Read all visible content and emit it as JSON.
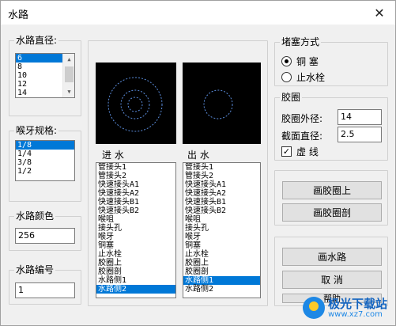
{
  "window": {
    "title": "水路",
    "close_glyph": "✕"
  },
  "pipe_diameter": {
    "legend": "水路直径:",
    "items": [
      "6",
      "8",
      "10",
      "12",
      "14"
    ],
    "selected_index": 0
  },
  "thread_spec": {
    "legend": "喉牙规格:",
    "items": [
      "1/8",
      "1/4",
      "3/8",
      "1/2"
    ],
    "selected_index": 0
  },
  "pipe_color": {
    "legend": "水路颜色",
    "value": "256"
  },
  "pipe_number": {
    "legend": "水路编号",
    "value": "1"
  },
  "inlet": {
    "label": "进 水",
    "items": [
      "管接头1",
      "管接头2",
      "快速接头A1",
      "快速接头A2",
      "快速接头B1",
      "快速接头B2",
      "喉咀",
      "接头孔",
      "喉牙",
      "铜塞",
      "止水栓",
      "胶圈上",
      "胶圈剖",
      "水路侧1",
      "水路侧2"
    ],
    "selected_index": 14
  },
  "outlet": {
    "label": "出 水",
    "items": [
      "管接头1",
      "管接头2",
      "快速接头A1",
      "快速接头A2",
      "快速接头B1",
      "快速接头B2",
      "喉咀",
      "接头孔",
      "喉牙",
      "铜塞",
      "止水栓",
      "胶圈上",
      "胶圈剖",
      "水路侧1",
      "水路侧2"
    ],
    "selected_index": 13
  },
  "plug_type": {
    "legend": "堵塞方式",
    "options": [
      "铜 塞",
      "止水栓"
    ],
    "selected_index": 0
  },
  "o_ring": {
    "legend": "胶圈",
    "outer_label": "胶圈外径:",
    "outer_value": "14",
    "section_label": "截面直径:",
    "section_value": "2.5",
    "dashed_label": "虚 线",
    "dashed_checked": true,
    "check_glyph": "✓"
  },
  "buttons": {
    "draw_ring_top": "画胶圈上",
    "draw_ring_section": "画胶圈剖",
    "draw_pipe": "画水路",
    "cancel": "取 消",
    "help": "帮助"
  },
  "watermark": {
    "name": "极光下载站",
    "url": "www.xz7.com"
  },
  "colors": {
    "selection": "#0078d7",
    "preview_bg": "#000000",
    "preview_stroke": "#5b8ddc"
  }
}
